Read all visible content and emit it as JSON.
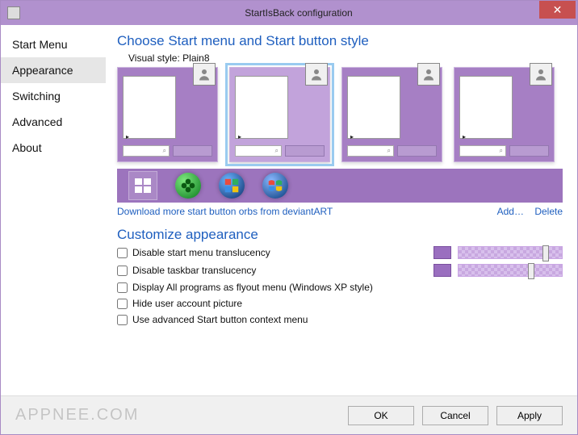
{
  "window": {
    "title": "StartIsBack configuration",
    "close_label": "Close"
  },
  "sidebar": {
    "items": [
      {
        "label": "Start Menu"
      },
      {
        "label": "Appearance"
      },
      {
        "label": "Switching"
      },
      {
        "label": "Advanced"
      },
      {
        "label": "About"
      }
    ],
    "selected_index": 1
  },
  "main": {
    "style_header": "Choose Start menu and Start button style",
    "visual_style_label": "Visual style:  Plain8",
    "orb_link": "Download more start button orbs from deviantART",
    "add_link": "Add…",
    "delete_link": "Delete",
    "customize_header": "Customize appearance",
    "options": [
      {
        "label": "Disable start menu translucency",
        "checked": false,
        "has_slider": true
      },
      {
        "label": "Disable taskbar translucency",
        "checked": false,
        "has_slider": true
      },
      {
        "label": "Display All programs as flyout menu (Windows XP style)",
        "checked": false,
        "has_slider": false
      },
      {
        "label": "Hide user account picture",
        "checked": false,
        "has_slider": false
      },
      {
        "label": "Use advanced Start button context menu",
        "checked": false,
        "has_slider": false
      }
    ]
  },
  "buttons": {
    "ok": "OK",
    "cancel": "Cancel",
    "apply": "Apply"
  },
  "watermark": "APPNEE.COM"
}
